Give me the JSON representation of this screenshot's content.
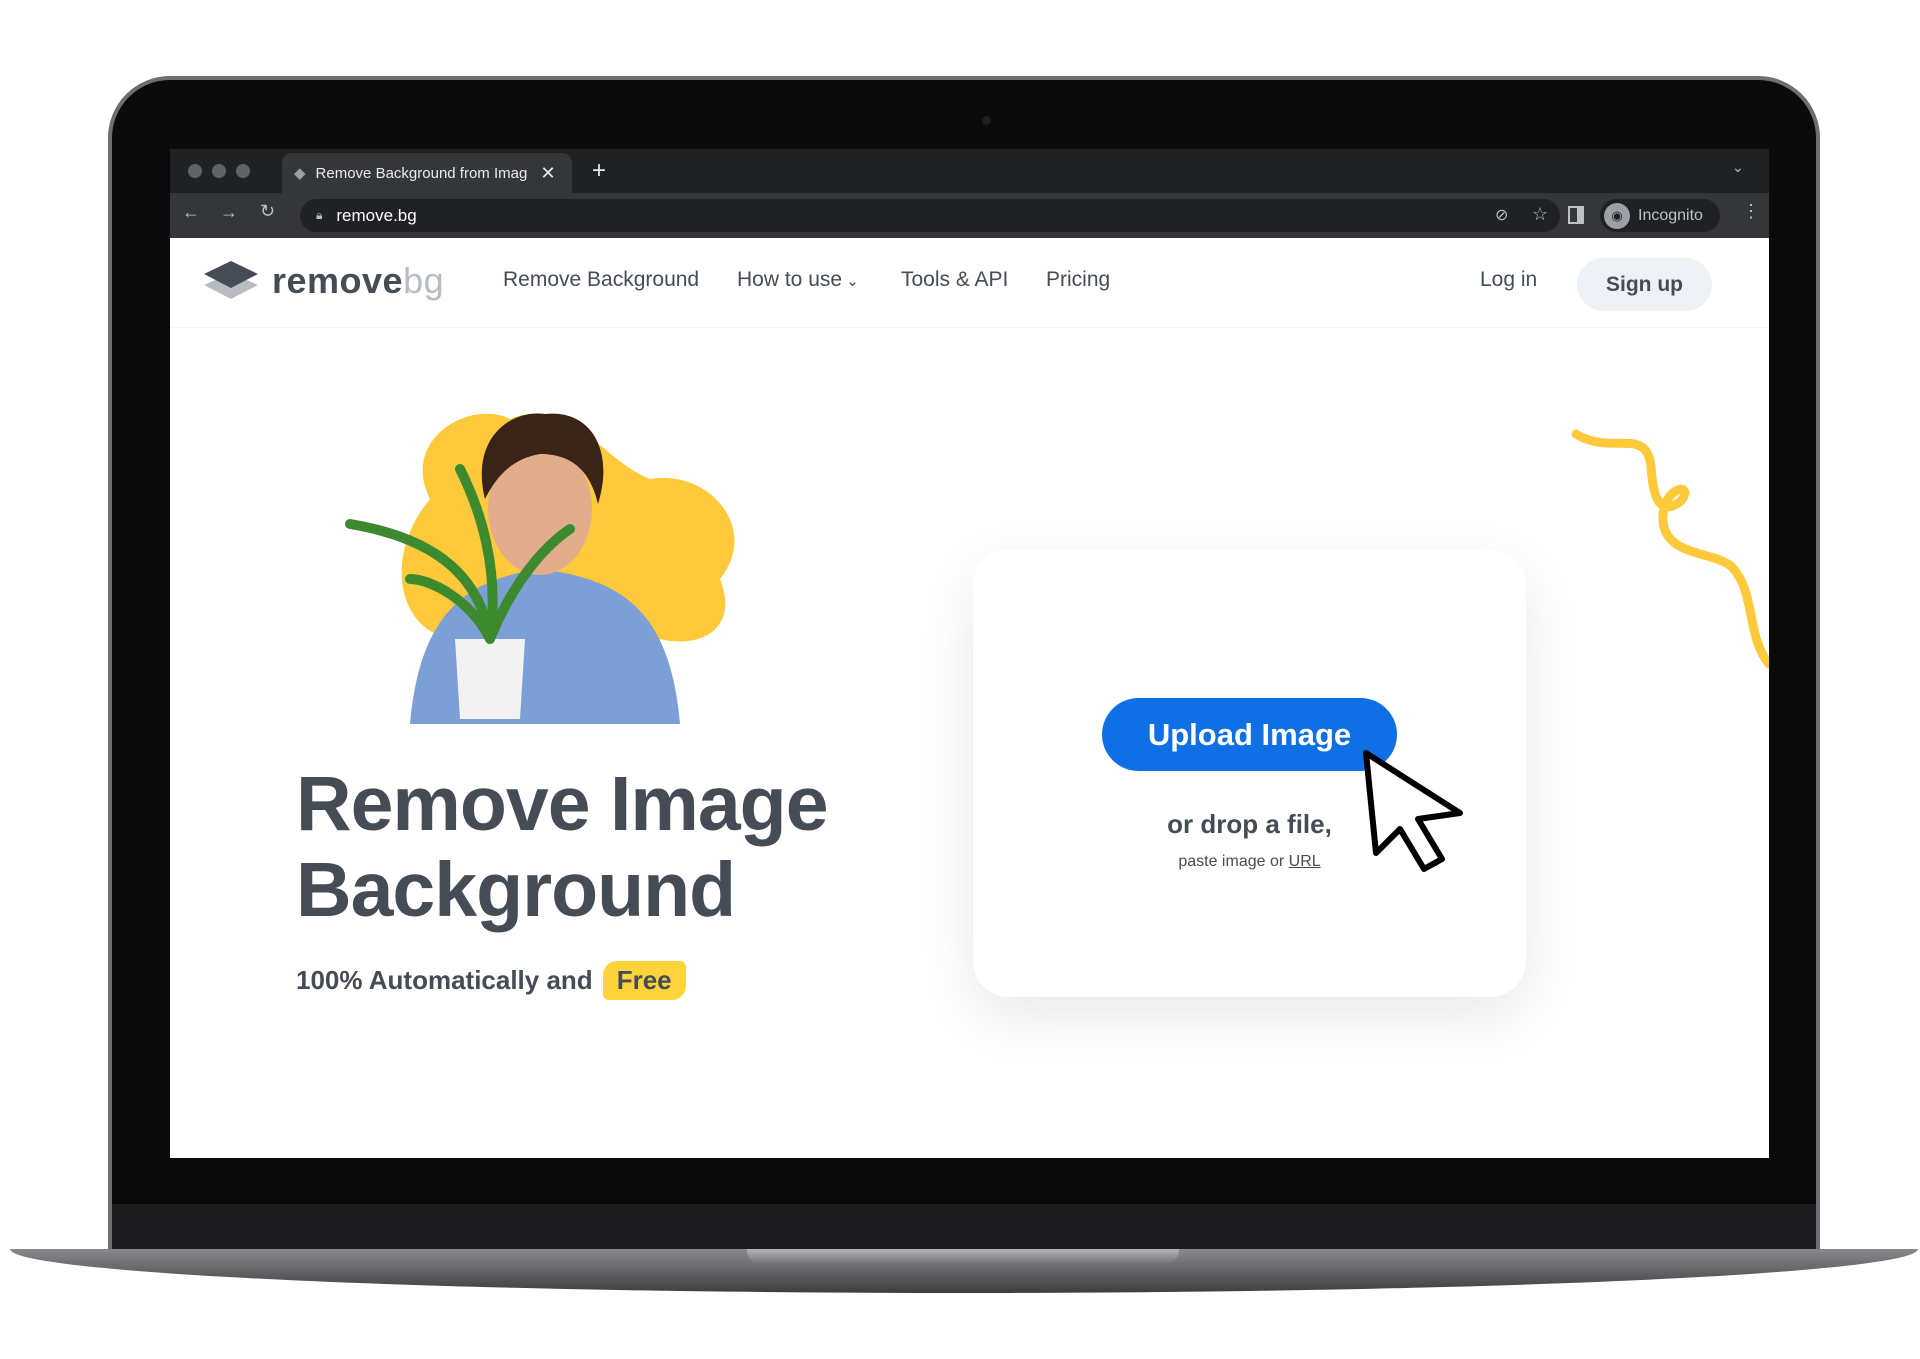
{
  "browser": {
    "tab_title": "Remove Background from Imag",
    "url": "remove.bg",
    "profile_label": "Incognito",
    "icons": [
      "close-icon",
      "new-tab-icon",
      "back-icon",
      "forward-icon",
      "reload-icon",
      "lock-icon",
      "eye-off-icon",
      "star-icon",
      "side-panel-icon",
      "incognito-icon",
      "menu-icon",
      "tab-search-icon"
    ]
  },
  "nav": {
    "logo_main": "remove",
    "logo_sub": "bg",
    "items": [
      {
        "label": "Remove Background"
      },
      {
        "label": "How to use"
      },
      {
        "label": "Tools & API"
      },
      {
        "label": "Pricing"
      }
    ],
    "login": "Log in",
    "signup": "Sign up"
  },
  "hero": {
    "title_line1": "Remove Image",
    "title_line2": "Background",
    "subtitle": "100% Automatically and",
    "highlight": "Free"
  },
  "upload": {
    "button": "Upload Image",
    "drop_text": "or drop a file,",
    "paste_text": "paste image or",
    "url_link": "URL"
  },
  "colors": {
    "accent": "#0f70e6",
    "highlight": "#ffd43b",
    "text": "#454c55"
  }
}
